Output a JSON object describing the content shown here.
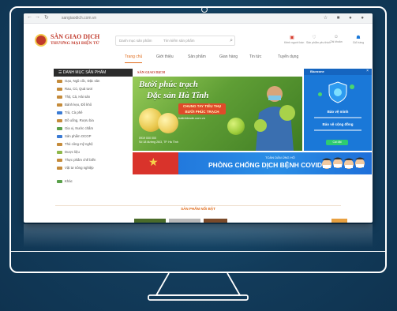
{
  "browser": {
    "url": "sangiaodich.com.vn",
    "nav_back": "←",
    "nav_forward": "→",
    "nav_reload": "↻",
    "icons_text": "☆ ■ ● ●"
  },
  "header": {
    "logo_line1": "SÀN GIAO DỊCH",
    "logo_line2": "THƯƠNG MẠI ĐIỆN TỬ",
    "search_category": "Danh mục sản phẩm",
    "search_placeholder": "Tìm kiếm sản phẩm",
    "search_icon": "⌕",
    "icons": [
      {
        "symbol": "▣",
        "label": "Kênh người bán",
        "color": "#d63a2b"
      },
      {
        "symbol": "♡",
        "label": "Sản phẩm yêu thích",
        "color": "#888888"
      },
      {
        "symbol": "☺",
        "label": "Tài khoản",
        "color": "#888888"
      },
      {
        "symbol": "☗",
        "label": "Giỏ hàng",
        "color": "#1a78d8"
      }
    ]
  },
  "nav_tabs": [
    "Trang chủ",
    "Giới thiệu",
    "Sản phẩm",
    "Gian hàng",
    "Tin tức",
    "Tuyển dụng"
  ],
  "sidebar": {
    "title": "☰ DANH MỤC SẢN PHẨM",
    "items": [
      "Gạo, Ngũ cốc, Đặc sản",
      "Rau, Củ, Quả tươi",
      "Thịt, Cá, Hải sản",
      "Bánh kẹo, Đồ khô",
      "Trà, Cà phê",
      "Đồ uống, Rượu bia",
      "Gia vị, Nước chấm",
      "Sản phẩm OCOP",
      "Thủ công mỹ nghệ",
      "Dược liệu",
      "Thực phẩm chế biến",
      "Vật tư nông nghiệp",
      "Khác"
    ]
  },
  "banner": {
    "brand": "SÀN GIAO DỊCH",
    "headline1": "Bưởi phúc trạch",
    "headline2": "Đặc sản Hà Tĩnh",
    "cta_line1": "CHUNG TAY TIÊU THỤ",
    "cta_line2": "BƯỞI PHÚC TRẠCH",
    "url": "hatinhtrade.com.vn",
    "info_line1": "0919 000 000",
    "info_line2": "Số 18 đường 26/3, TP. Hà Tĩnh"
  },
  "app_card": {
    "title": "Bluezone",
    "close": "×",
    "line1": "Bảo vệ mình",
    "line2": "Bảo vệ cộng đồng",
    "button": "Cài đặt"
  },
  "covid": {
    "small": "TOÀN DÂN ỦNG HỘ",
    "main": "PHÒNG CHỐNG DỊCH BỆNH COVID-19",
    "star": "★"
  },
  "products": {
    "title": "SẢN PHẨM NỔI BẬT"
  },
  "colors": {
    "accent": "#e06b1a",
    "brand_red": "#c0392b",
    "app_blue": "#1a78d8"
  }
}
